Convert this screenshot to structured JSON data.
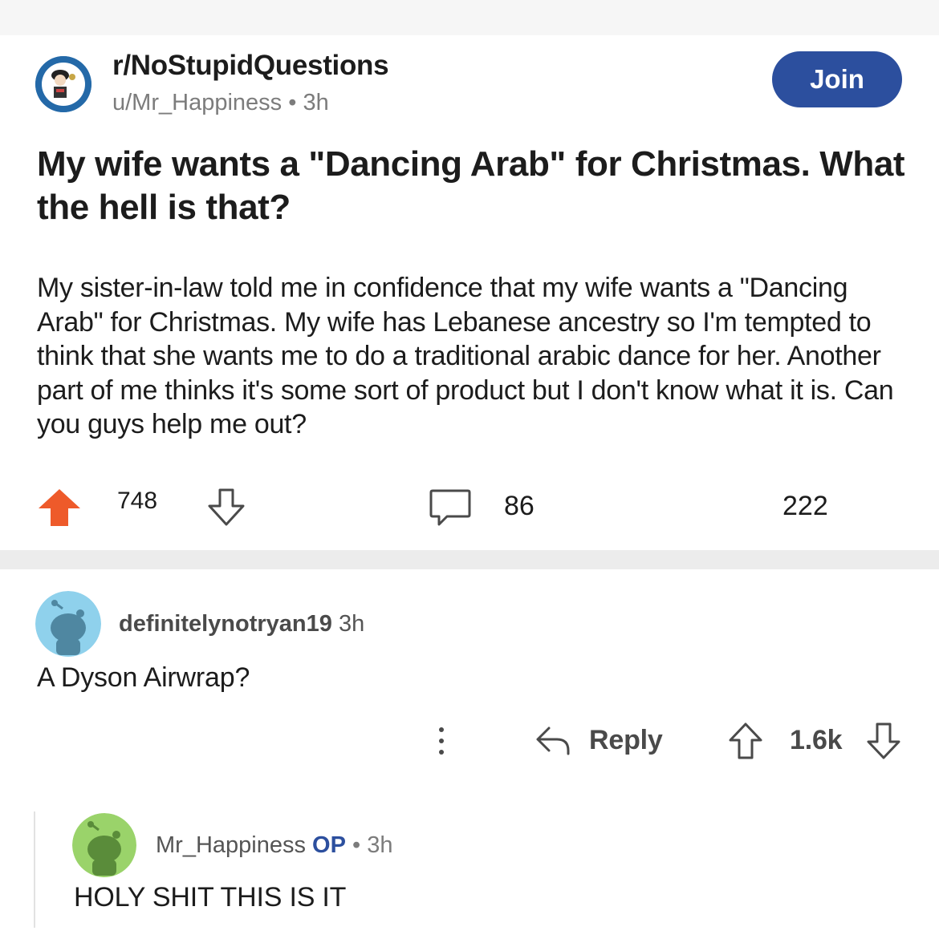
{
  "post": {
    "subreddit": "r/NoStupidQuestions",
    "author": "u/Mr_Happiness",
    "separator": "•",
    "age": "3h",
    "join_label": "Join",
    "title": "My wife wants a \"Dancing Arab\" for Christmas. What the hell is that?",
    "body": "My sister-in-law told me in confidence that my wife wants a \"Dancing Arab\" for Christmas. My wife has Lebanese ancestry so I'm tempted to think that she wants me to do a traditional arabic dance for her. Another part of me thinks it's some sort of product but I don't know what it is. Can you guys help me out?",
    "score": "748",
    "comments": "86",
    "shares": "222",
    "icons": {
      "subreddit_avatar": "subreddit-avatar-icon",
      "upvote": "upvote-arrow-icon",
      "downvote": "downvote-arrow-icon",
      "comment": "comment-bubble-icon"
    },
    "colors": {
      "upvote": "#ee5a2a",
      "join": "#2c4f9e"
    }
  },
  "comments": [
    {
      "author": "definitelynotryan19",
      "age": "3h",
      "text": "A Dyson Airwrap?",
      "reply_label": "Reply",
      "score": "1.6k",
      "avatar_color": "#8fd1ec",
      "icons": [
        "more-options-icon",
        "reply-arrow-icon",
        "upvote-arrow-icon",
        "downvote-arrow-icon"
      ]
    },
    {
      "author": "Mr_Happiness",
      "op_label": "OP",
      "separator": "•",
      "age": "3h",
      "text": "HOLY SHIT THIS IS IT",
      "avatar_color": "#9ad36a"
    }
  ]
}
